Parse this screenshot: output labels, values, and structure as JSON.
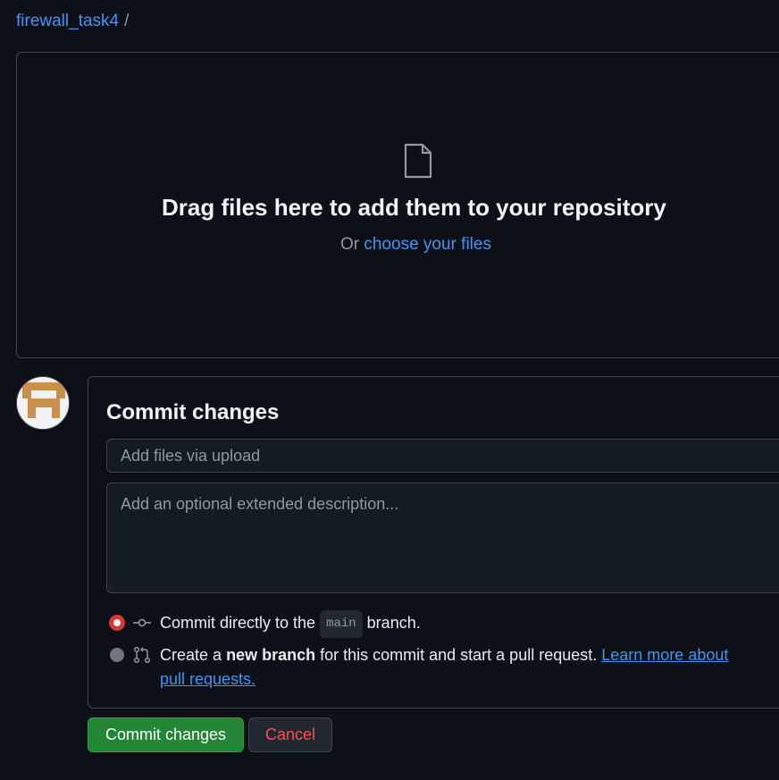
{
  "breadcrumb": {
    "repo": "firewall_task4",
    "separator": "/"
  },
  "dropzone": {
    "title": "Drag files here to add them to your repository",
    "or_text": "Or",
    "choose_link": "choose your files"
  },
  "commit": {
    "heading": "Commit changes",
    "summary_placeholder": "Add files via upload",
    "summary_value": "",
    "description_placeholder": "Add an optional extended description...",
    "option_direct": {
      "prefix": "Commit directly to the",
      "branch": "main",
      "suffix": "branch.",
      "selected": true
    },
    "option_new_branch": {
      "prefix": "Create a",
      "bold": "new branch",
      "suffix": "for this commit and start a pull request.",
      "link": "Learn more about pull requests.",
      "selected": false
    }
  },
  "buttons": {
    "commit": "Commit changes",
    "cancel": "Cancel"
  },
  "colors": {
    "background": "#0d1117",
    "link": "#4493f8",
    "primary_button": "#238636",
    "danger_text": "#f85149",
    "radio_accent": "#da3633"
  },
  "icons": {
    "file": "file-icon",
    "commit": "git-commit-icon",
    "pull_request": "git-pull-request-icon",
    "avatar": "identicon-avatar"
  }
}
